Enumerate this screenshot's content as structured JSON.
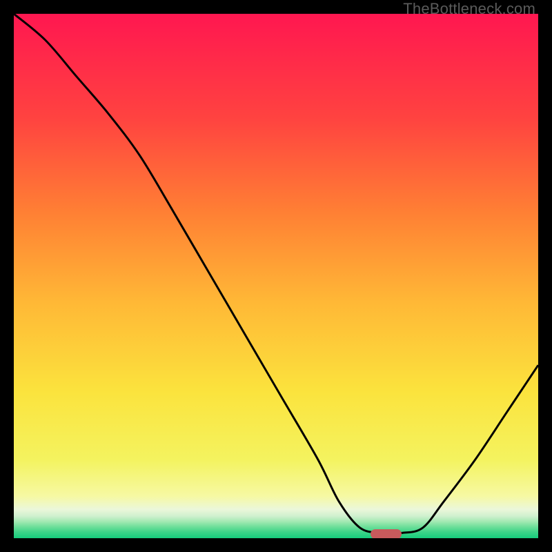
{
  "watermark": "TheBottleneck.com",
  "colors": {
    "bg_black": "#000000",
    "curve": "#000000",
    "marker": "#c85a5c",
    "gradient_stops": [
      {
        "offset": 0.0,
        "color": "#ff1750"
      },
      {
        "offset": 0.2,
        "color": "#ff4340"
      },
      {
        "offset": 0.38,
        "color": "#ff8034"
      },
      {
        "offset": 0.55,
        "color": "#ffb836"
      },
      {
        "offset": 0.72,
        "color": "#fbe33d"
      },
      {
        "offset": 0.85,
        "color": "#f4f35f"
      },
      {
        "offset": 0.92,
        "color": "#f6f9a3"
      },
      {
        "offset": 0.945,
        "color": "#ebf7da"
      },
      {
        "offset": 0.958,
        "color": "#cff1ce"
      },
      {
        "offset": 0.968,
        "color": "#a4e9b3"
      },
      {
        "offset": 0.978,
        "color": "#6fdf9a"
      },
      {
        "offset": 0.988,
        "color": "#3ed489"
      },
      {
        "offset": 1.0,
        "color": "#16cc7c"
      }
    ]
  },
  "chart_data": {
    "type": "line",
    "title": "",
    "xlabel": "",
    "ylabel": "",
    "xlim": [
      0,
      100
    ],
    "ylim": [
      0,
      100
    ],
    "series": [
      {
        "name": "bottleneck-curve",
        "x": [
          0,
          6,
          12,
          18,
          24,
          30,
          37,
          44,
          51,
          58,
          62,
          66,
          70,
          74,
          78,
          82,
          88,
          94,
          100
        ],
        "y": [
          100,
          95,
          88,
          81,
          73,
          63,
          51,
          39,
          27,
          15,
          7,
          2,
          1,
          1,
          2,
          7,
          15,
          24,
          33
        ]
      }
    ],
    "marker": {
      "name": "target",
      "x_start": 68,
      "x_end": 74,
      "y": 0.8
    }
  }
}
